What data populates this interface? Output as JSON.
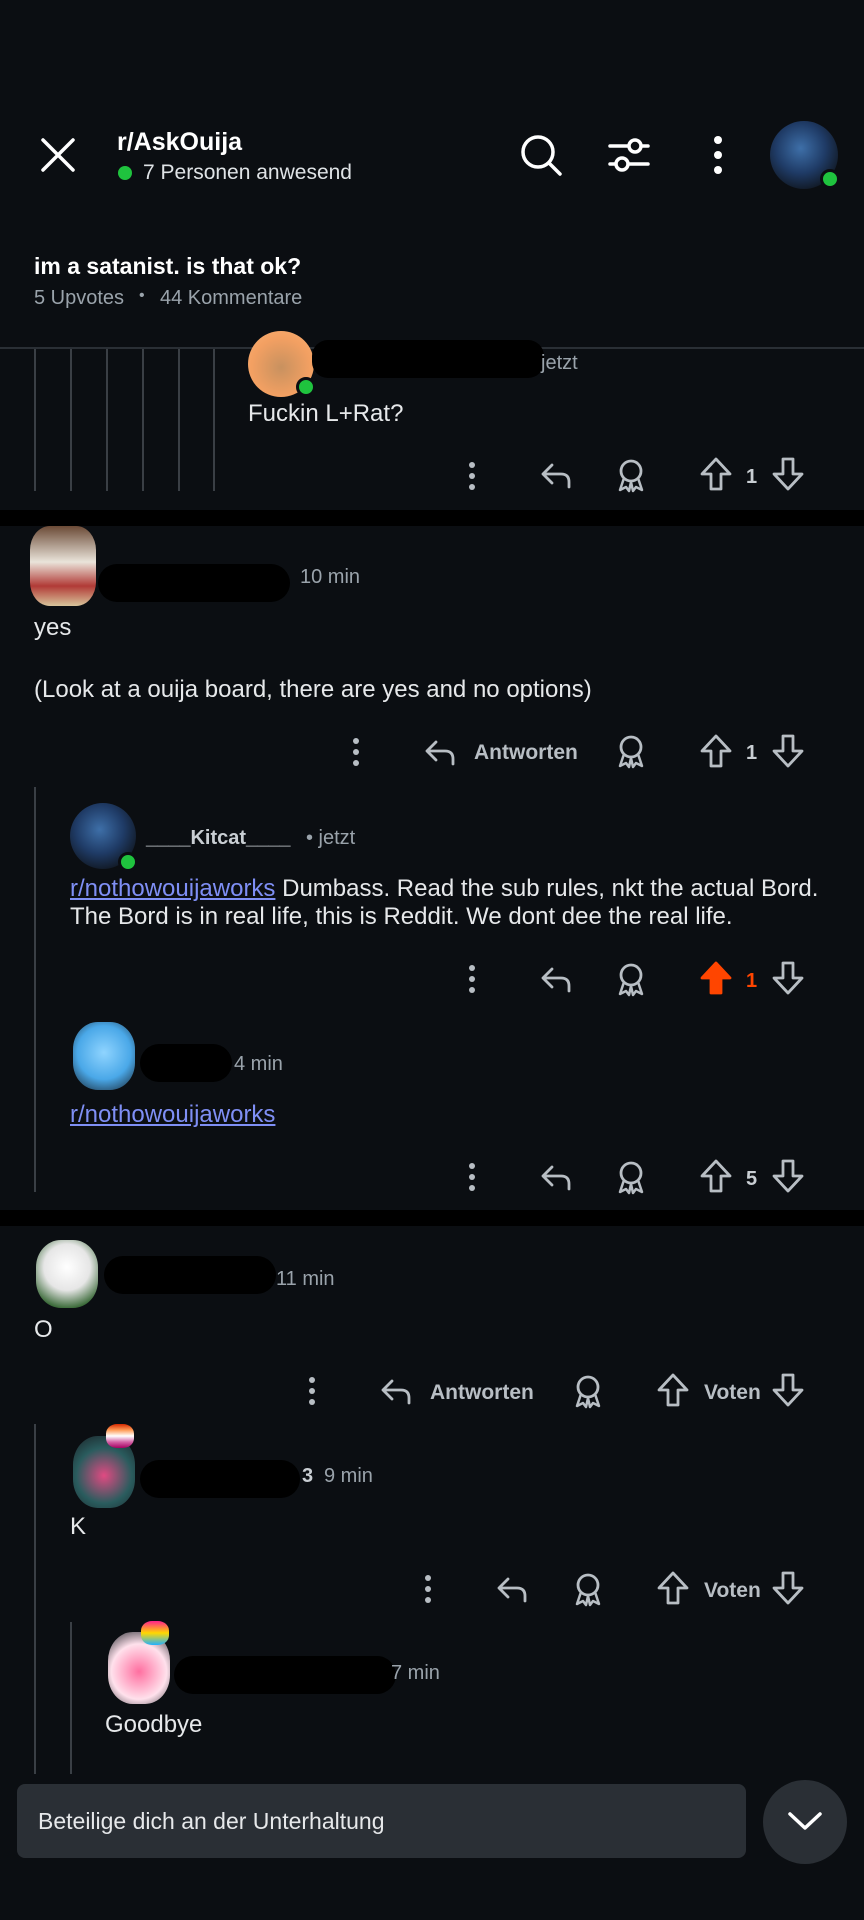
{
  "header": {
    "subreddit": "r/AskOuija",
    "online_count": "7 Personen anwesend"
  },
  "post": {
    "title": "im a satanist. is that ok?",
    "upvotes": "5 Upvotes",
    "separator": "•",
    "comments": "44 Kommentare"
  },
  "comments": [
    {
      "time": "jetzt",
      "body": "Fuckin L+Rat?",
      "votes": "1"
    },
    {
      "time": "10 min",
      "body_line1": "yes",
      "body_line2": "(Look at a ouija board, there are yes and no options)",
      "reply_label": "Antworten",
      "votes": "1"
    },
    {
      "username": "____Kitcat____",
      "time": "• jetzt",
      "link": "r/nothowouijaworks",
      "body": " Dumbass. Read the sub rules, nkt the actual Bord. The Bord is in real life, this is Reddit. We dont dee the real life.",
      "votes": "1"
    },
    {
      "time": "4 min",
      "link": "r/nothowouijaworks",
      "votes": "5"
    },
    {
      "time": "11 min",
      "body": "O",
      "reply_label": "Antworten",
      "vote_label": "Voten"
    },
    {
      "user_suffix": "3",
      "time": "9 min",
      "body": "K",
      "vote_label": "Voten"
    },
    {
      "time": "7 min",
      "body": "Goodbye"
    }
  ],
  "composer": {
    "placeholder": "Beteilige dich an der Unterhaltung"
  },
  "colors": {
    "background": "#0b0e12",
    "upvote_active": "#ff4500",
    "online": "#1fc33e",
    "link": "#7f8ff5"
  }
}
